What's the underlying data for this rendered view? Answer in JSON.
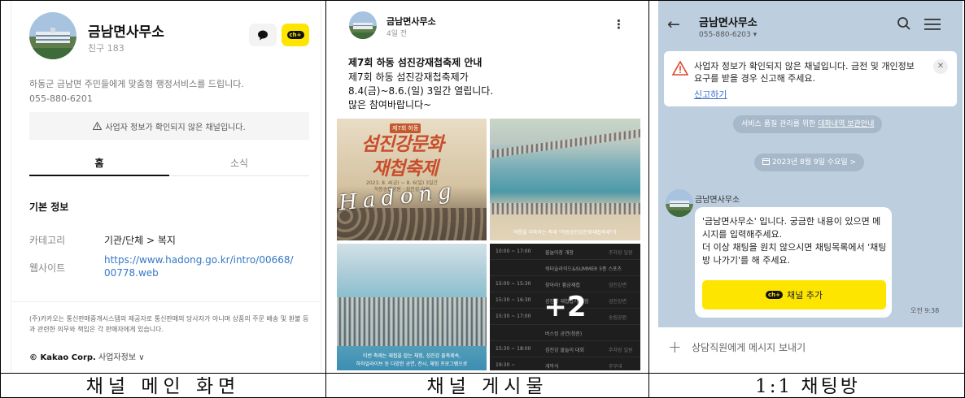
{
  "profile": {
    "name": "금남면사무소",
    "friends": "친구 183",
    "desc_line1": "하동군 금남면 주민들에게 맞춤형 행정서비스를 드립니다.",
    "desc_line2": "055-880-6201",
    "warning": "사업자 정보가 확인되지 않은 채널입니다.",
    "add_icon_text": "ch+",
    "tabs": [
      "홈",
      "소식"
    ],
    "section_title": "기본 정보",
    "info": [
      {
        "label": "카테고리",
        "value": "기관/단체 > 복지"
      },
      {
        "label": "웹사이트",
        "value": "https://www.hadong.go.kr/intro/00668/00778.web"
      }
    ],
    "legal": "(주)카카오는 통신판매중개시스템의 제공자로 통신판매의 당사자가 아니며 상품의 주문 배송 및 환불 등과 관련한 의무와 책임은 각 판매자에게 있습니다.",
    "corp_brand": "© Kakao Corp.",
    "corp_link": "사업자정보 ∨"
  },
  "post": {
    "channel": "금남면사무소",
    "time": "4일 전",
    "more_icon": "⋮",
    "title": "제7회 하동 섬진강재첩축제 안내",
    "body_lines": [
      "제7회 하동 섬진강재첩축제가",
      "8.4(금)~8.6.(일) 3일간 열립니다.",
      "많은 참여바랍니다~"
    ],
    "poster": {
      "badge": "제7회 하동",
      "title1": "섬진강문화",
      "title2": "재첩축제",
      "date_line1": "2023. 8. 4(금) ~ 8. 6(일) 3일간",
      "date_line2": "하동송림공원 · 섬진강 일원",
      "script": "Hadong"
    },
    "photo1_caption": "여름을 더욱하는 축제 \"하동섬진강문화재첩축제\"가",
    "photo2_caption_line1": "이번 축제는 재첩을 잡는 체험, 섬진강 물축제속,",
    "photo2_caption_line2": "하하얼라이브 등 다양한 공연, 전시, 체험 프로그램으로",
    "schedule": [
      {
        "time": "10:00 ~ 17:00",
        "event": "물놀이장 개장",
        "place": "주차장 일원"
      },
      {
        "time": "",
        "event": "워터슬라이드&SUMMER 5종 스포츠",
        "place": ""
      },
      {
        "time": "15:00 ~ 15:30",
        "event": "찾아라! 황금재첩",
        "place": "섬진강변"
      },
      {
        "time": "15:30 ~ 16:30",
        "event": "섬진강 재첩잡기 체험",
        "place": "섬진강변"
      },
      {
        "time": "15:30 ~ 17:00",
        "event": "",
        "place": "송림공원"
      },
      {
        "time": "",
        "event": "버스킹 공연(청춘)",
        "place": ""
      },
      {
        "time": "15:30 ~ 18:00",
        "event": "섬진강 물놀이 대회",
        "place": "주차장 일원"
      },
      {
        "time": "19:30 ~",
        "event": "개막식",
        "place": "주무대"
      }
    ],
    "more_count": "+2"
  },
  "chat": {
    "back_icon": "←",
    "name": "금남면사무소",
    "phone": "055-880-6203 ▾",
    "warning_text": "사업자 정보가 확인되지 않은 채널입니다. 금전 및 개인정보 요구를 받을 경우 신고해 주세요.",
    "report_link": "신고하기",
    "close_icon": "✕",
    "notice_prefix": "서비스 품질 관리를 위한 ",
    "notice_link": "대화내역 보관안내",
    "date_pill": "2023년 8월 9일 수요일 >",
    "sender": "금남면사무소",
    "message_lines": [
      "'금남면사무소' 입니다.  궁금한 내용이 있으면 메시지를 입력해주세요.",
      "더 이상 채팅을 원치 않으시면 채팅목록에서 '채팅방 나가기'를 해 주세요."
    ],
    "add_icon_text": "ch+",
    "add_button": "채널 추가",
    "msg_time": "오전 9:38",
    "input_plus": "+",
    "input_placeholder": "상담직원에게 메시지 보내기"
  },
  "captions": [
    "채널 메인 화면",
    "채널 게시물",
    "1:1 채팅방"
  ],
  "colors": {
    "kakao_yellow": "#fee500",
    "chat_bg": "#bdcede",
    "link_blue": "#3478c6",
    "warn_red": "#e0452b"
  },
  "icons": [
    "chat-bubble-icon",
    "channel-add-icon",
    "warning-triangle-icon",
    "more-vertical-icon",
    "back-arrow-icon",
    "search-icon",
    "menu-icon",
    "close-icon",
    "calendar-icon",
    "plus-icon"
  ]
}
